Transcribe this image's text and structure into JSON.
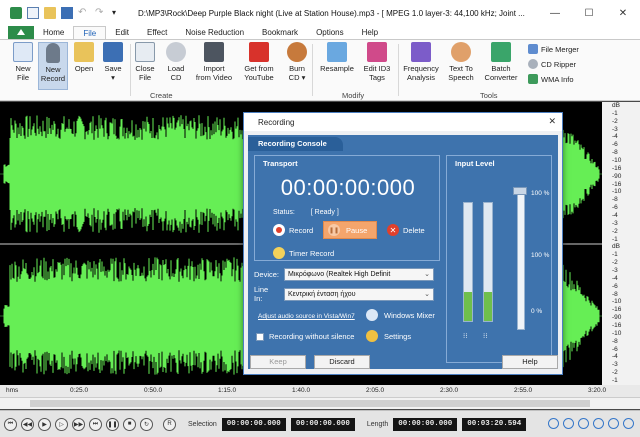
{
  "window": {
    "title": "D:\\MP3\\Rock\\Deep Purple  Black night (Live at Station House).mp3 - [ MPEG 1.0 layer-3: 44,100 kHz; Joint ...",
    "minimize": "—",
    "maximize": "☐",
    "close": "✕"
  },
  "menu_tabs": [
    "Home",
    "File",
    "Edit",
    "Effect",
    "Noise Reduction",
    "Bookmark",
    "Options",
    "Help"
  ],
  "active_tab": "File",
  "ribbon": {
    "buttons": [
      {
        "label": "New\nFile",
        "icon": "new-file-icon"
      },
      {
        "label": "New\nRecord",
        "icon": "microphone-icon"
      },
      {
        "label": "Open",
        "icon": "open-folder-icon"
      },
      {
        "label": "Save\n▾",
        "icon": "save-icon"
      },
      {
        "label": "Close\nFile",
        "icon": "close-file-icon"
      },
      {
        "label": "Load\nCD",
        "icon": "cd-icon"
      },
      {
        "label": "Import\nfrom Video",
        "icon": "film-icon"
      },
      {
        "label": "Get from\nYouTube",
        "icon": "youtube-icon"
      },
      {
        "label": "Burn\nCD ▾",
        "icon": "burn-cd-icon"
      },
      {
        "label": "Resample",
        "icon": "resample-icon"
      },
      {
        "label": "Edit ID3\nTags",
        "icon": "tag-icon"
      },
      {
        "label": "Frequency\nAnalysis",
        "icon": "frequency-icon"
      },
      {
        "label": "Text To\nSpeech",
        "icon": "speech-icon"
      },
      {
        "label": "Batch\nConverter",
        "icon": "batch-icon"
      }
    ],
    "small_buttons": [
      "File Merger",
      "CD Ripper",
      "WMA Info"
    ],
    "groups": [
      "Create",
      "Modify",
      "Tools"
    ]
  },
  "db_scale": [
    "dB",
    "-1",
    "-2",
    "-3",
    "-4",
    "-6",
    "-8",
    "-10",
    "-16",
    "-90",
    "-16",
    "-10",
    "-8",
    "-6",
    "-4",
    "-3",
    "-2",
    "-1",
    "dB",
    "-1",
    "-2",
    "-3",
    "-4",
    "-6",
    "-8",
    "-10",
    "-16",
    "-90",
    "-16",
    "-10",
    "-8",
    "-6",
    "-4",
    "-3",
    "-2",
    "-1"
  ],
  "timeline": [
    "hms",
    "0:25.0",
    "0:50.0",
    "1:15.0",
    "1:40.0",
    "2:05.0",
    "2:30.0",
    "2:55.0",
    "3:20.0"
  ],
  "status": {
    "selection_label": "Selection",
    "selection_start": "00:00:00.000",
    "selection_end": "00:00:00.000",
    "length_label": "Length",
    "length_start": "00:00:00.000",
    "length_end": "00:03:20.594"
  },
  "dialog": {
    "title": "Recording",
    "console_tab": "Recording Console",
    "transport_label": "Transport",
    "clock": "00:00:00:000",
    "status_label": "Status:",
    "status_value": "[ Ready ]",
    "record": "Record",
    "pause": "Pause",
    "delete": "Delete",
    "timer_record": "Timer Record",
    "input_level_label": "Input Level",
    "pct_top": "100 %",
    "pct_mid": "100 %",
    "pct_bottom": "0 %",
    "meter_level": 0.25,
    "device_label": "Device:",
    "device_value": "Μικρόφωνο (Realtek High Definit",
    "line_in_label": "Line In:",
    "line_in_value": "Κεντρική ένταση ήχου",
    "adjust_link": "Adjust audio source in Vista/Win7",
    "windows_mixer": "Windows Mixer",
    "recording_without_silence": "Recording without silence",
    "settings": "Settings",
    "keep": "Keep",
    "discard": "Discard",
    "help": "Help"
  },
  "colors": {
    "waveform": "#66ee55",
    "console_bg": "#3e73ad",
    "pause_bg": "#f4a56c",
    "app_green": "#2d8c4a"
  }
}
